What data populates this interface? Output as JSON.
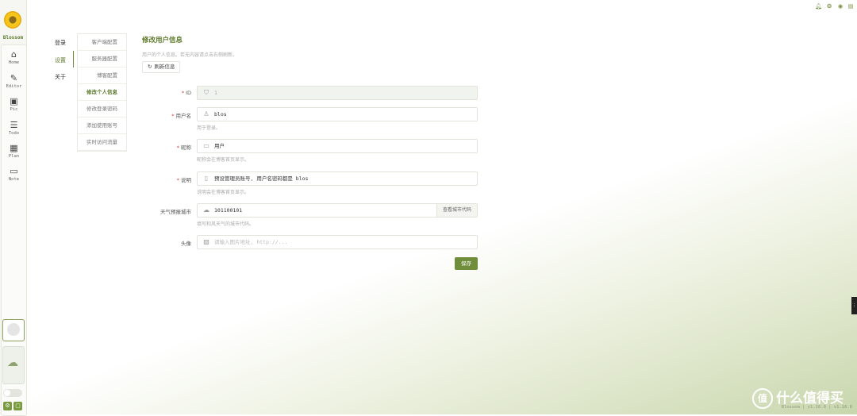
{
  "app": {
    "name": "Blossom"
  },
  "rail": {
    "items": [
      {
        "label": "Home",
        "icon": "home-icon",
        "glyph": "⌂"
      },
      {
        "label": "Editor",
        "icon": "editor-icon",
        "glyph": "✎"
      },
      {
        "label": "Pic",
        "icon": "picture-icon",
        "glyph": "▣"
      },
      {
        "label": "Todo",
        "icon": "todo-icon",
        "glyph": "☰"
      },
      {
        "label": "Plan",
        "icon": "calendar-icon",
        "glyph": "▦"
      },
      {
        "label": "Note",
        "icon": "note-icon",
        "glyph": "▭"
      }
    ]
  },
  "settings_nav": {
    "items": [
      "登录",
      "设置",
      "关于"
    ],
    "active_index": 1
  },
  "sub_nav": {
    "items": [
      "客户端配置",
      "服务器配置",
      "博客配置",
      "修改个人信息",
      "修改登录密码",
      "添加使用账号",
      "实时访问流量"
    ],
    "active_index": 3
  },
  "main": {
    "title": "修改用户信息",
    "description": "用户的个人信息。若无内容请点击右侧刷新。",
    "refresh_label": "刷新信息",
    "fields": {
      "id": {
        "label": "ID",
        "value": "1"
      },
      "username": {
        "label": "用户名",
        "value": "blos",
        "hint": "用于登录。"
      },
      "nickname": {
        "label": "昵称",
        "value": "用户",
        "hint": "昵称会在博客首页显示。"
      },
      "remark": {
        "label": "说明",
        "value": "预设管理员账号, 用户名密码都是 blos",
        "hint": "说明会在博客首页显示。"
      },
      "weather": {
        "label": "天气预报城市",
        "value": "101100101",
        "addon": "查看城市代码",
        "hint": "填写和风天气的城市代码。"
      },
      "avatar": {
        "label": "头像",
        "placeholder": "请输入图片地址, http://..."
      }
    },
    "save_label": "保存"
  },
  "watermark": {
    "text": "什么值得买",
    "glyph": "值"
  },
  "footer": {
    "version": "Blossom | v1.16.0 | v1.16.0"
  },
  "colors": {
    "accent": "#6f8d3a",
    "accent_text": "#5d7a2b"
  }
}
